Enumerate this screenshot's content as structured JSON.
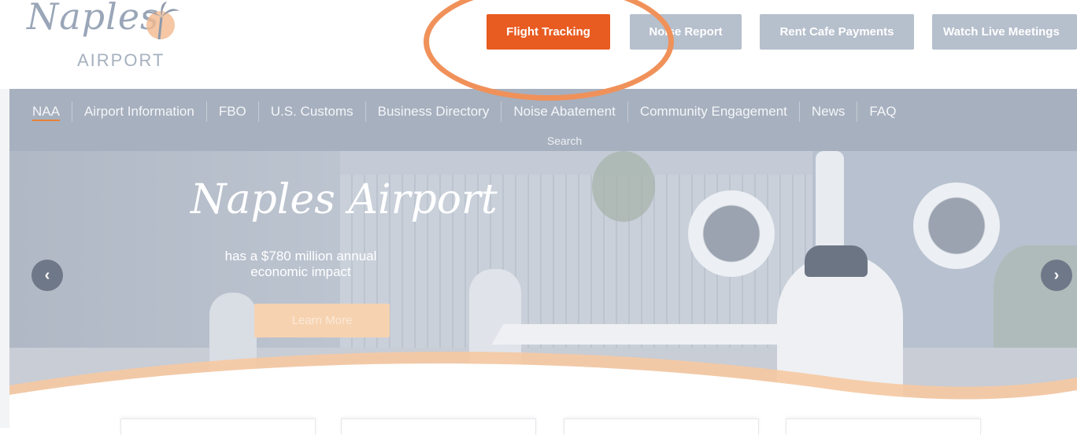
{
  "logo": {
    "script_text": "Naples",
    "sub_text": "AIRPORT"
  },
  "top_buttons": [
    {
      "label": "Flight Tracking",
      "color": "#e85b21"
    },
    {
      "label": "Noise Report",
      "color": "#b6bfcc"
    },
    {
      "label": "Rent Cafe Payments",
      "color": "#b6bfcc"
    },
    {
      "label": "Watch Live Meetings",
      "color": "#b6bfcc"
    }
  ],
  "nav": {
    "items": [
      {
        "label": "NAA",
        "active": true
      },
      {
        "label": "Airport Information"
      },
      {
        "label": "FBO"
      },
      {
        "label": "U.S. Customs"
      },
      {
        "label": "Business Directory"
      },
      {
        "label": "Noise Abatement"
      },
      {
        "label": "Community Engagement"
      },
      {
        "label": "News"
      },
      {
        "label": "FAQ"
      }
    ],
    "search_label": "Search"
  },
  "hero": {
    "script_title": "Naples Airport",
    "subtitle": "has a $780 million annual economic impact",
    "button_label": "Learn More",
    "prev_arrow": "‹",
    "next_arrow": "›"
  },
  "colors": {
    "accent": "#e85b21",
    "nav_bg": "#a7b0be",
    "highlight_ring": "#f0915a"
  }
}
